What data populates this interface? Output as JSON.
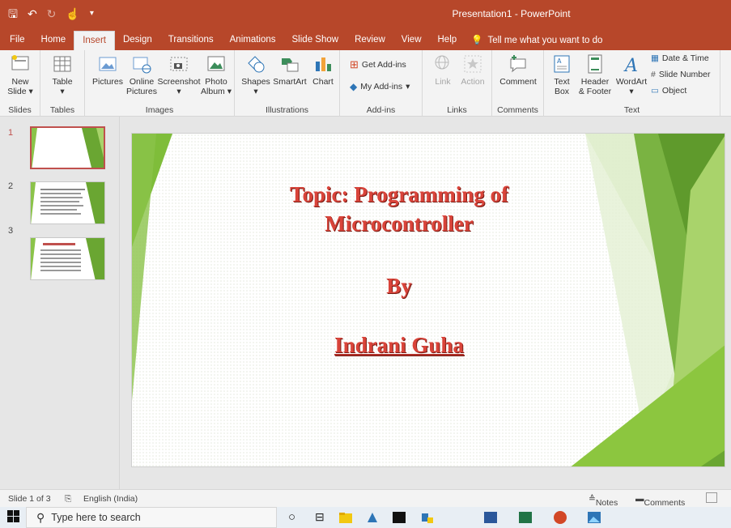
{
  "window": {
    "title": "Presentation1  -  PowerPoint"
  },
  "qat": {
    "save_icon": "save-icon",
    "undo_icon": "undo-icon",
    "redo_icon": "redo-icon",
    "touch_icon": "touch-mode-icon",
    "customize_icon": "chevron-down-icon"
  },
  "tabs": [
    {
      "label": "File"
    },
    {
      "label": "Home"
    },
    {
      "label": "Insert",
      "active": true
    },
    {
      "label": "Design"
    },
    {
      "label": "Transitions"
    },
    {
      "label": "Animations"
    },
    {
      "label": "Slide Show"
    },
    {
      "label": "Review"
    },
    {
      "label": "View"
    },
    {
      "label": "Help"
    }
  ],
  "tell_me": "Tell me what you want to do",
  "ribbon": {
    "slides": {
      "label": "Slides",
      "new_slide": "New",
      "new_slide2": "Slide"
    },
    "tables": {
      "label": "Tables",
      "table": "Table"
    },
    "images": {
      "label": "Images",
      "pictures": "Pictures",
      "online": "Online",
      "online2": "Pictures",
      "screenshot": "Screenshot",
      "photo": "Photo",
      "photo2": "Album"
    },
    "illustrations": {
      "label": "Illustrations",
      "shapes": "Shapes",
      "smartart": "SmartArt",
      "chart": "Chart"
    },
    "addins": {
      "label": "Add-ins",
      "get": "Get Add-ins",
      "my": "My Add-ins"
    },
    "links": {
      "label": "Links",
      "link": "Link",
      "action": "Action"
    },
    "comments": {
      "label": "Comments",
      "comment": "Comment"
    },
    "text": {
      "label": "Text",
      "textbox": "Text",
      "textbox2": "Box",
      "header": "Header",
      "header2": "& Footer",
      "wordart": "WordArt",
      "datetime": "Date & Time",
      "slidenum": "Slide Number",
      "object": "Object"
    }
  },
  "thumbnails": [
    {
      "num": "1",
      "selected": true
    },
    {
      "num": "2"
    },
    {
      "num": "3"
    }
  ],
  "slide": {
    "title_line1": "Topic: Programming of",
    "title_line2": "Microcontroller",
    "by": "By",
    "author": "Indrani Guha"
  },
  "status": {
    "slide": "Slide 1 of 3",
    "language": "English (India)",
    "notes": "Notes",
    "comments": "Comments"
  },
  "taskbar": {
    "search_placeholder": "Type here to search"
  },
  "colors": {
    "accent": "#b7472a",
    "slide_text": "#d9443a",
    "green_dark": "#6aa632",
    "green_light": "#a9d36b"
  }
}
